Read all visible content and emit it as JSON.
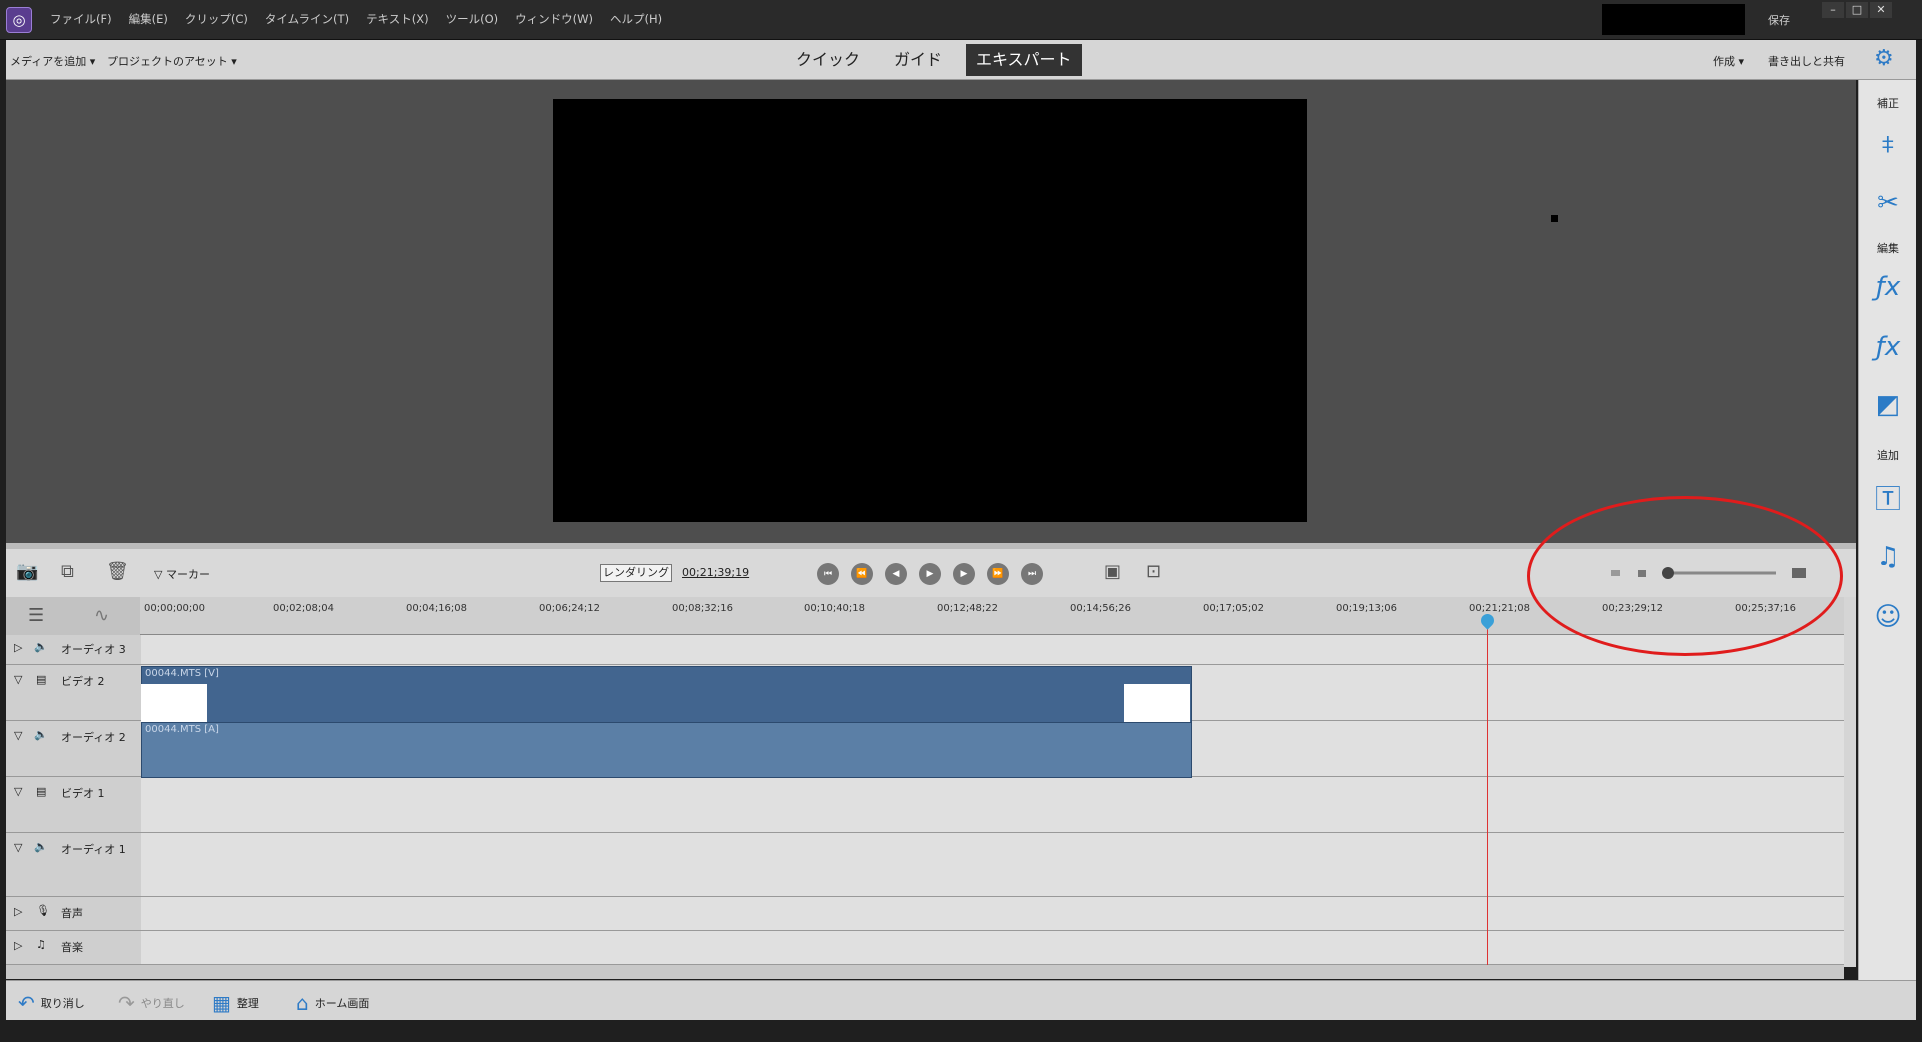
{
  "menubar": {
    "items": [
      "ファイル(F)",
      "編集(E)",
      "クリップ(C)",
      "タイムライン(T)",
      "テキスト(X)",
      "ツール(O)",
      "ウィンドウ(W)",
      "ヘルプ(H)"
    ],
    "save_label": "保存",
    "min": "–",
    "max": "□",
    "close": "✕"
  },
  "modebar": {
    "add_media": "メディアを追加 ▾",
    "project_assets": "プロジェクトのアセット ▾",
    "modes": [
      "クイック",
      "ガイド",
      "エキスパート"
    ],
    "active_mode": "エキスパート",
    "create": "作成 ▾",
    "export_share": "書き出しと共有"
  },
  "sidebar": {
    "sections": [
      "補正",
      "編集",
      "追加"
    ]
  },
  "controls": {
    "marker": "▽ マーカー",
    "render": "レンダリング",
    "timecode": "00;21;39;19"
  },
  "ruler": {
    "ticks": [
      "00;00;00;00",
      "00;02;08;04",
      "00;04;16;08",
      "00;06;24;12",
      "00;08;32;16",
      "00;10;40;18",
      "00;12;48;22",
      "00;14;56;26",
      "00;17;05;02",
      "00;19;13;06",
      "00;21;21;08",
      "00;23;29;12",
      "00;25;37;16"
    ]
  },
  "tracks": [
    {
      "label": "オーディオ 3"
    },
    {
      "label": "ビデオ 2"
    },
    {
      "label": "オーディオ 2"
    },
    {
      "label": "ビデオ 1"
    },
    {
      "label": "オーディオ 1"
    },
    {
      "label": "音声"
    },
    {
      "label": "音楽"
    }
  ],
  "clips": {
    "video": "00044.MTS [V]",
    "audio": "00044.MTS [A]"
  },
  "bottombar": {
    "undo": "取り消し",
    "redo": "やり直し",
    "organize": "整理",
    "home": "ホーム画面"
  },
  "colors": {
    "accent": "#2f7bc6",
    "clip_video": "#42658f",
    "clip_audio": "#5b7fa6",
    "playhead": "#dd3333",
    "annotation": "#e01c1c"
  }
}
